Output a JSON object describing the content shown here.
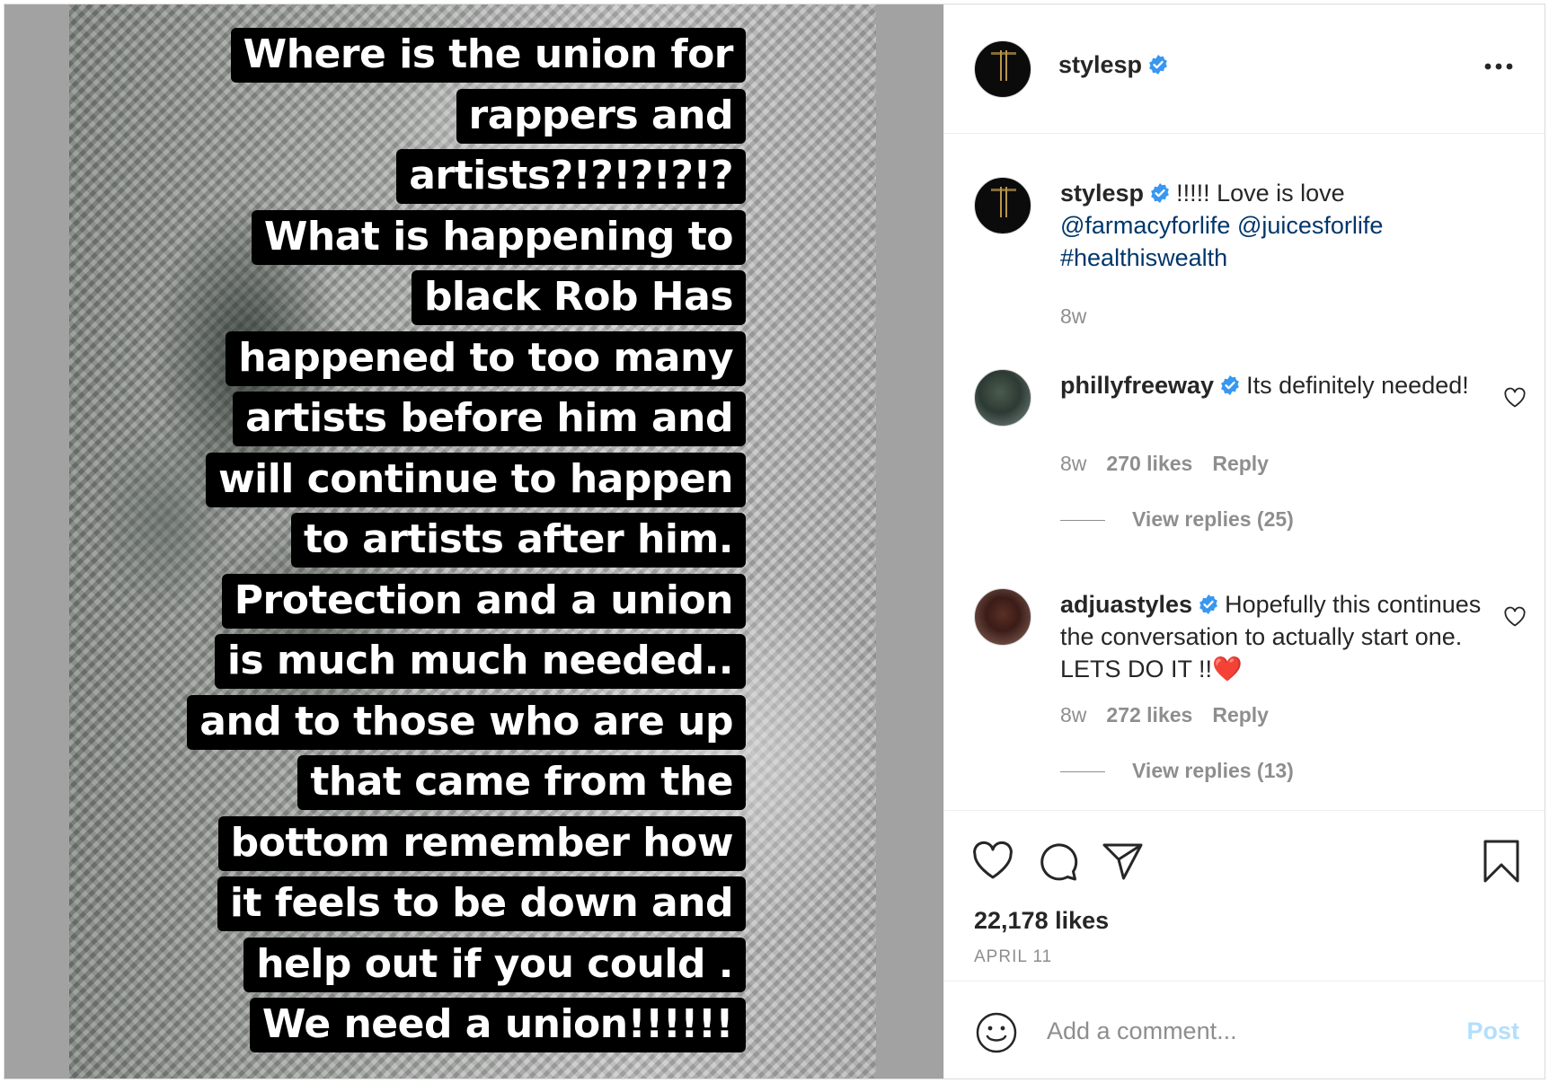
{
  "post": {
    "author": "stylesp",
    "story_lines": [
      "Where is the  union for",
      "rappers and",
      "artists?!?!?!?!?",
      "What is happening to",
      "black Rob Has",
      "happened  to  too many",
      "artists before him  and",
      "will continue to happen",
      "to artists after him.",
      "Protection and a union",
      "is much much needed..",
      "and to those who are up",
      "that came from the",
      "bottom remember how",
      "it feels to be down and",
      "help out if you could .",
      "We need a union!!!!!!"
    ]
  },
  "header": {
    "username": "stylesp",
    "verified_icon": "verified-badge-icon",
    "more_icon": "more-options-icon"
  },
  "caption": {
    "username": "stylesp",
    "text": "!!!!! Love is love",
    "mention1": "@farmacyforlife",
    "mention2": "@juicesforlife",
    "hashtag": "#healthiswealth",
    "time": "8w"
  },
  "comments": [
    {
      "username": "phillyfreeway",
      "text": "Its definitely needed!",
      "time": "8w",
      "likes": "270 likes",
      "reply": "Reply",
      "view_replies": "View replies (25)"
    },
    {
      "username": "adjuastyles",
      "text": "Hopefully this continues the conversation to actually start one. LETS DO IT !!❤️",
      "time": "8w",
      "likes": "272 likes",
      "reply": "Reply",
      "view_replies": "View replies (13)"
    }
  ],
  "actions": {
    "likes": "22,178 likes",
    "date": "APRIL 11"
  },
  "add_comment": {
    "placeholder": "Add a comment...",
    "post_label": "Post"
  },
  "colors": {
    "link": "#00376b",
    "verified": "#3897f0",
    "secondary_text": "#8e8e8e",
    "post_disabled": "#b2dffc"
  }
}
